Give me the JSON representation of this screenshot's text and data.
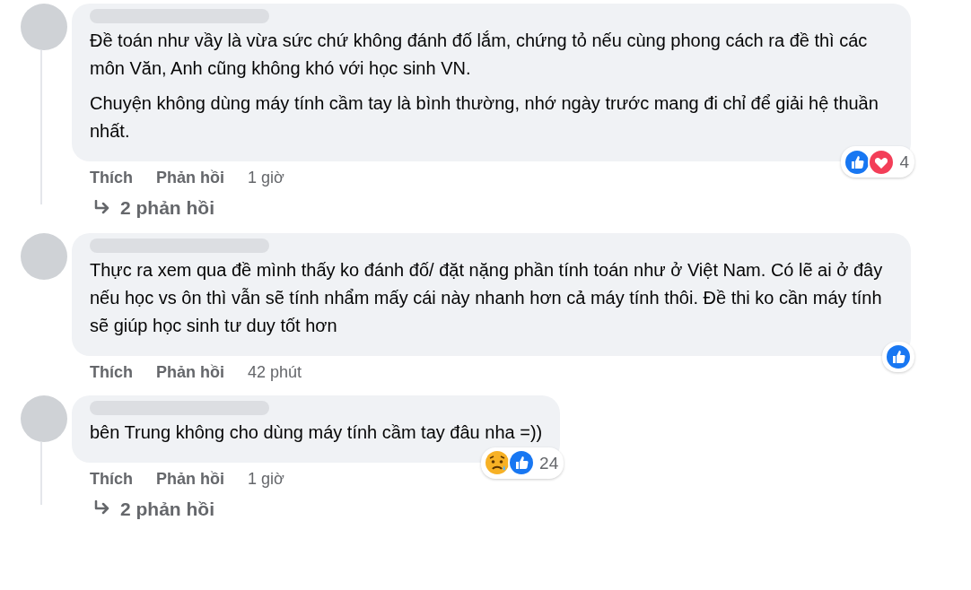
{
  "comments": [
    {
      "paragraphs": [
        "Đề toán như vầy là vừa sức chứ không đánh đố lắm, chứng tỏ nếu cùng phong cách ra đề thì các môn Văn, Anh cũng không khó với học sinh VN.",
        "Chuyện không dùng máy tính cầm tay là bình thường, nhớ ngày trước mang đi chỉ để giải hệ thuần nhất."
      ],
      "reactions": [
        {
          "kind": "like"
        },
        {
          "kind": "love"
        }
      ],
      "reaction_count": "4",
      "actions": {
        "like": "Thích",
        "reply": "Phản hồi",
        "time": "1 giờ"
      },
      "replies": "2 phản hồi"
    },
    {
      "paragraphs": [
        "Thực ra xem qua đề mình thấy ko đánh đố/ đặt nặng phần tính toán như ở Việt Nam. Có lẽ ai ở đây nếu học vs ôn thì vẫn sẽ tính nhẩm mấy cái này nhanh hơn cả máy tính thôi. Đề thi ko cần máy tính sẽ giúp học sinh tư duy tốt hơn"
      ],
      "reactions": [
        {
          "kind": "like"
        }
      ],
      "actions": {
        "like": "Thích",
        "reply": "Phản hồi",
        "time": "42 phút"
      }
    },
    {
      "paragraphs": [
        "bên Trung không cho dùng máy tính cầm tay đâu nha =))"
      ],
      "reactions": [
        {
          "kind": "sad"
        },
        {
          "kind": "like"
        }
      ],
      "reaction_count": "24",
      "actions": {
        "like": "Thích",
        "reply": "Phản hồi",
        "time": "1 giờ"
      },
      "replies": "2 phản hồi"
    }
  ]
}
